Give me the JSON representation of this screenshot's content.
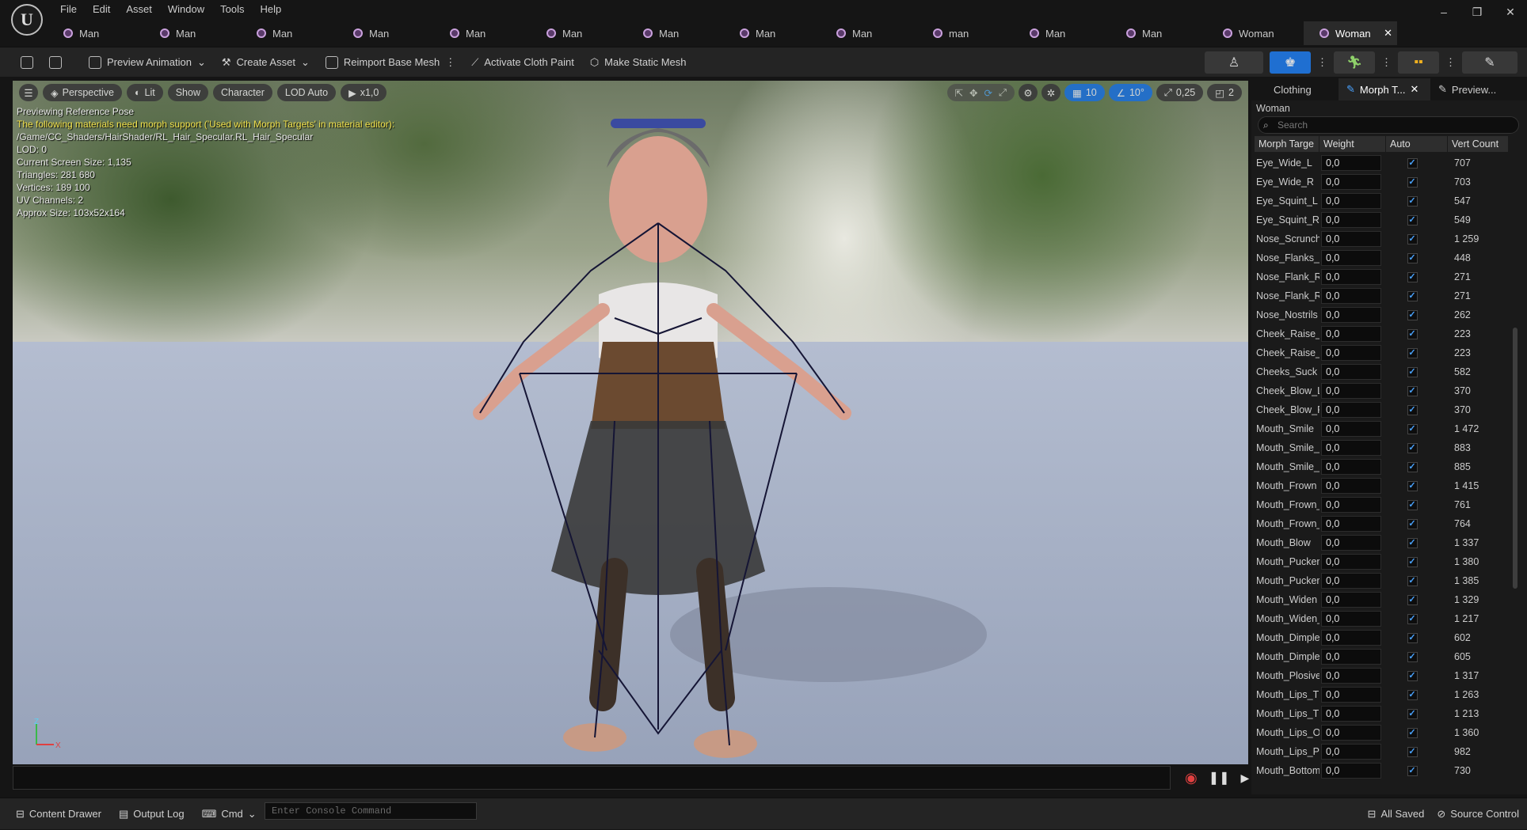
{
  "app": {
    "logo": "U",
    "menu": [
      "File",
      "Edit",
      "Asset",
      "Window",
      "Tools",
      "Help"
    ],
    "window_buttons": [
      "–",
      "❐",
      "✕"
    ]
  },
  "tabs": [
    {
      "label": "Man",
      "active": false
    },
    {
      "label": "Man",
      "active": false
    },
    {
      "label": "Man",
      "active": false
    },
    {
      "label": "Man",
      "active": false
    },
    {
      "label": "Man",
      "active": false
    },
    {
      "label": "Man",
      "active": false
    },
    {
      "label": "Man",
      "active": false
    },
    {
      "label": "Man",
      "active": false
    },
    {
      "label": "Man",
      "active": false
    },
    {
      "label": "man",
      "active": false
    },
    {
      "label": "Man",
      "active": false
    },
    {
      "label": "Man",
      "active": false
    },
    {
      "label": "Woman",
      "active": false
    },
    {
      "label": "Woman",
      "active": true,
      "close": "✕"
    }
  ],
  "toolbar": {
    "preview_animation": "Preview Animation",
    "create_asset": "Create Asset",
    "reimport": "Reimport Base Mesh",
    "cloth_paint": "Activate Cloth Paint",
    "static_mesh": "Make Static Mesh"
  },
  "viewport": {
    "perspective": "Perspective",
    "lit": "Lit",
    "show": "Show",
    "character": "Character",
    "lod": "LOD Auto",
    "speed": "x1,0",
    "grid": "10",
    "angle": "10°",
    "scale": "0,25",
    "camera": "2",
    "info_title": "Previewing Reference Pose",
    "info_warning": "The following materials need morph support ('Used with Morph Targets' in material editor):",
    "info_path": "/Game/CC_Shaders/HairShader/RL_Hair_Specular.RL_Hair_Specular",
    "info_lod": "LOD: 0",
    "info_screen": "Current Screen Size: 1,135",
    "info_tris": "Triangles: 281 680",
    "info_verts": "Vertices: 189 100",
    "info_uv": "UV Channels: 2",
    "info_size": "Approx Size: 103x52x164",
    "axis_z": "Z",
    "axis_x": "X"
  },
  "statusbar": {
    "content_drawer": "Content Drawer",
    "output_log": "Output Log",
    "cmd": "Cmd",
    "console_placeholder": "Enter Console Command",
    "all_saved": "All Saved",
    "source_control": "Source Control"
  },
  "panel": {
    "tabs": [
      "Clothing",
      "Morph T...",
      "Preview..."
    ],
    "title": "Woman",
    "search_placeholder": "Search",
    "columns": [
      "Morph Targe",
      "Weight",
      "Auto",
      "Vert Count"
    ],
    "rows": [
      {
        "name": "Eye_Wide_L",
        "weight": "0,0",
        "auto": true,
        "verts": "707"
      },
      {
        "name": "Eye_Wide_R",
        "weight": "0,0",
        "auto": true,
        "verts": "703"
      },
      {
        "name": "Eye_Squint_L",
        "weight": "0,0",
        "auto": true,
        "verts": "547"
      },
      {
        "name": "Eye_Squint_R",
        "weight": "0,0",
        "auto": true,
        "verts": "549"
      },
      {
        "name": "Nose_Scrunch",
        "weight": "0,0",
        "auto": true,
        "verts": "1 259"
      },
      {
        "name": "Nose_Flanks_",
        "weight": "0,0",
        "auto": true,
        "verts": "448"
      },
      {
        "name": "Nose_Flank_R",
        "weight": "0,0",
        "auto": true,
        "verts": "271"
      },
      {
        "name": "Nose_Flank_R",
        "weight": "0,0",
        "auto": true,
        "verts": "271"
      },
      {
        "name": "Nose_Nostrils",
        "weight": "0,0",
        "auto": true,
        "verts": "262"
      },
      {
        "name": "Cheek_Raise_",
        "weight": "0,0",
        "auto": true,
        "verts": "223"
      },
      {
        "name": "Cheek_Raise_",
        "weight": "0,0",
        "auto": true,
        "verts": "223"
      },
      {
        "name": "Cheeks_Suck",
        "weight": "0,0",
        "auto": true,
        "verts": "582"
      },
      {
        "name": "Cheek_Blow_L",
        "weight": "0,0",
        "auto": true,
        "verts": "370"
      },
      {
        "name": "Cheek_Blow_R",
        "weight": "0,0",
        "auto": true,
        "verts": "370"
      },
      {
        "name": "Mouth_Smile",
        "weight": "0,0",
        "auto": true,
        "verts": "1 472"
      },
      {
        "name": "Mouth_Smile_",
        "weight": "0,0",
        "auto": true,
        "verts": "883"
      },
      {
        "name": "Mouth_Smile_",
        "weight": "0,0",
        "auto": true,
        "verts": "885"
      },
      {
        "name": "Mouth_Frown",
        "weight": "0,0",
        "auto": true,
        "verts": "1 415"
      },
      {
        "name": "Mouth_Frown_",
        "weight": "0,0",
        "auto": true,
        "verts": "761"
      },
      {
        "name": "Mouth_Frown_",
        "weight": "0,0",
        "auto": true,
        "verts": "764"
      },
      {
        "name": "Mouth_Blow",
        "weight": "0,0",
        "auto": true,
        "verts": "1 337"
      },
      {
        "name": "Mouth_Pucker",
        "weight": "0,0",
        "auto": true,
        "verts": "1 380"
      },
      {
        "name": "Mouth_Pucker",
        "weight": "0,0",
        "auto": true,
        "verts": "1 385"
      },
      {
        "name": "Mouth_Widen",
        "weight": "0,0",
        "auto": true,
        "verts": "1 329"
      },
      {
        "name": "Mouth_Widen_",
        "weight": "0,0",
        "auto": true,
        "verts": "1 217"
      },
      {
        "name": "Mouth_Dimple",
        "weight": "0,0",
        "auto": true,
        "verts": "602"
      },
      {
        "name": "Mouth_Dimple",
        "weight": "0,0",
        "auto": true,
        "verts": "605"
      },
      {
        "name": "Mouth_Plosive",
        "weight": "0,0",
        "auto": true,
        "verts": "1 317"
      },
      {
        "name": "Mouth_Lips_T",
        "weight": "0,0",
        "auto": true,
        "verts": "1 263"
      },
      {
        "name": "Mouth_Lips_T",
        "weight": "0,0",
        "auto": true,
        "verts": "1 213"
      },
      {
        "name": "Mouth_Lips_O",
        "weight": "0,0",
        "auto": true,
        "verts": "1 360"
      },
      {
        "name": "Mouth_Lips_P",
        "weight": "0,0",
        "auto": true,
        "verts": "982"
      },
      {
        "name": "Mouth_Bottom",
        "weight": "0,0",
        "auto": true,
        "verts": "730"
      }
    ]
  }
}
